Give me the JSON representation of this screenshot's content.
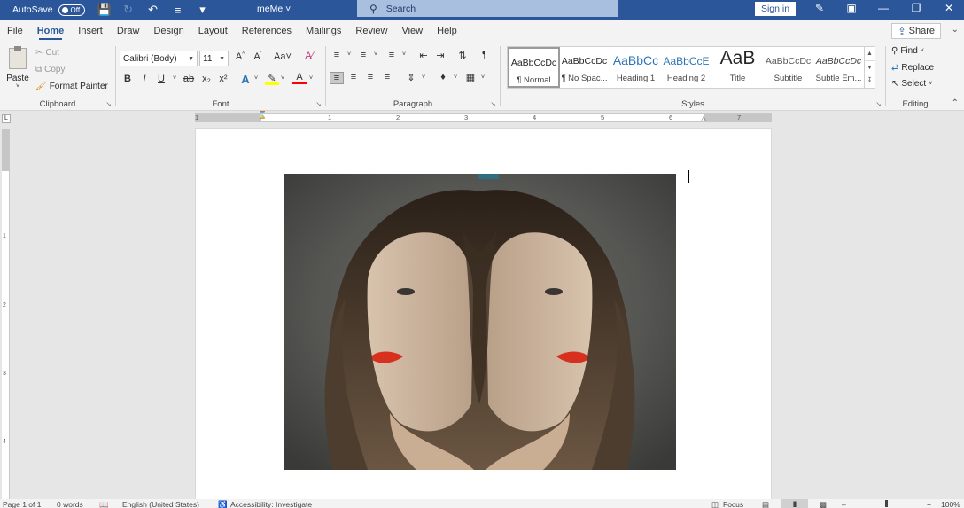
{
  "titlebar": {
    "autosave_label": "AutoSave",
    "autosave_state": "Off",
    "doc_title": "meMe",
    "search_placeholder": "Search",
    "signin_label": "Sign in"
  },
  "tabs": [
    "File",
    "Home",
    "Insert",
    "Draw",
    "Design",
    "Layout",
    "References",
    "Mailings",
    "Review",
    "View",
    "Help"
  ],
  "active_tab": "Home",
  "share_label": "Share",
  "clipboard": {
    "paste_label": "Paste",
    "cut_label": "Cut",
    "copy_label": "Copy",
    "format_painter_label": "Format Painter",
    "group_label": "Clipboard"
  },
  "font": {
    "font_name": "Calibri (Body)",
    "font_size": "11",
    "group_label": "Font",
    "grow_label": "A^",
    "shrink_label": "A˅",
    "case_label": "Aa",
    "bold_label": "B",
    "italic_label": "I",
    "underline_label": "U",
    "strike_label": "ab",
    "sub_label": "x₂",
    "sup_label": "x²"
  },
  "paragraph": {
    "group_label": "Paragraph"
  },
  "styles": {
    "group_label": "Styles",
    "items": [
      {
        "sample": "AaBbCcDc",
        "name": "¶ Normal"
      },
      {
        "sample": "AaBbCcDc",
        "name": "¶ No Spac..."
      },
      {
        "sample": "AaBbCc",
        "name": "Heading 1"
      },
      {
        "sample": "AaBbCcE",
        "name": "Heading 2"
      },
      {
        "sample": "AaB",
        "name": "Title"
      },
      {
        "sample": "AaBbCcDc",
        "name": "Subtitle"
      },
      {
        "sample": "AaBbCcDc",
        "name": "Subtle Em..."
      }
    ]
  },
  "editing": {
    "find_label": "Find",
    "replace_label": "Replace",
    "select_label": "Select",
    "group_label": "Editing"
  },
  "ruler": {
    "h_numbers": [
      "1",
      "1",
      "2",
      "3",
      "4",
      "5",
      "6",
      "7"
    ],
    "v_numbers": [
      "1",
      "2",
      "3",
      "4"
    ]
  },
  "statusbar": {
    "page": "Page 1 of 1",
    "words": "0 words",
    "language": "English (United States)",
    "accessibility": "Accessibility: Investigate",
    "focus": "Focus",
    "zoom": "100%"
  },
  "colors": {
    "brand": "#2b579a",
    "highlight": "#ffff00",
    "font_color": "#ff0000",
    "text_effects": "#2e75b6"
  }
}
